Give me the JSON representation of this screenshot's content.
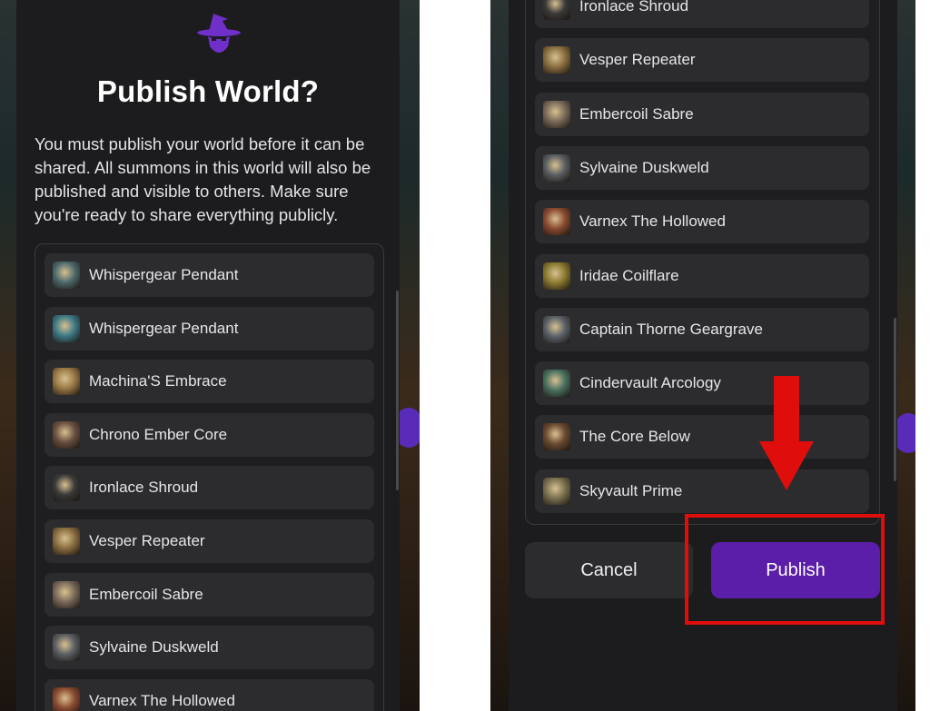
{
  "dialog": {
    "title": "Publish World?",
    "description": "You must publish your world before it can be shared. All summons in this world will also be published and visible to others. Make sure you're ready to share everything publicly."
  },
  "left_items": [
    {
      "label": "Whispergear Pendant",
      "icon": "pendant-thumbnail",
      "color": "#4e6a6e"
    },
    {
      "label": "Whispergear Pendant",
      "icon": "pendant-thumbnail",
      "color": "#3d7a86"
    },
    {
      "label": "Machina'S Embrace",
      "icon": "gear-thumbnail",
      "color": "#9a7a46"
    },
    {
      "label": "Chrono Ember Core",
      "icon": "core-thumbnail",
      "color": "#6a5040"
    },
    {
      "label": "Ironlace Shroud",
      "icon": "shroud-thumbnail",
      "color": "#3a3a3a"
    },
    {
      "label": "Vesper Repeater",
      "icon": "repeater-thumbnail",
      "color": "#8a6e40"
    },
    {
      "label": "Embercoil Sabre",
      "icon": "sabre-thumbnail",
      "color": "#7a6a5a"
    },
    {
      "label": "Sylvaine Duskweld",
      "icon": "character-thumbnail",
      "color": "#5a5e62"
    },
    {
      "label": "Varnex The Hollowed",
      "icon": "character-thumbnail",
      "color": "#8a4a30"
    }
  ],
  "right_items": [
    {
      "label": "Ironlace Shroud",
      "icon": "shroud-thumbnail",
      "color": "#3a3a3a"
    },
    {
      "label": "Vesper Repeater",
      "icon": "repeater-thumbnail",
      "color": "#8a6e40"
    },
    {
      "label": "Embercoil Sabre",
      "icon": "sabre-thumbnail",
      "color": "#7a6a5a"
    },
    {
      "label": "Sylvaine Duskweld",
      "icon": "character-thumbnail",
      "color": "#5a5e62"
    },
    {
      "label": "Varnex The Hollowed",
      "icon": "character-thumbnail",
      "color": "#8a4a30"
    },
    {
      "label": "Iridae Coilflare",
      "icon": "character-thumbnail",
      "color": "#8a7a30"
    },
    {
      "label": "Captain Thorne Geargrave",
      "icon": "character-thumbnail",
      "color": "#5a6068"
    },
    {
      "label": "Cindervault Arcology",
      "icon": "location-thumbnail",
      "color": "#4a7060"
    },
    {
      "label": "The Core Below",
      "icon": "location-thumbnail",
      "color": "#6a4a30"
    },
    {
      "label": "Skyvault Prime",
      "icon": "location-thumbnail",
      "color": "#7a7050"
    }
  ],
  "actions": {
    "cancel_label": "Cancel",
    "publish_label": "Publish"
  },
  "colors": {
    "accent": "#5b1ea8",
    "annotation": "#e00d0d",
    "modal_bg": "#1c1c1e",
    "item_bg": "#2c2c2e"
  }
}
